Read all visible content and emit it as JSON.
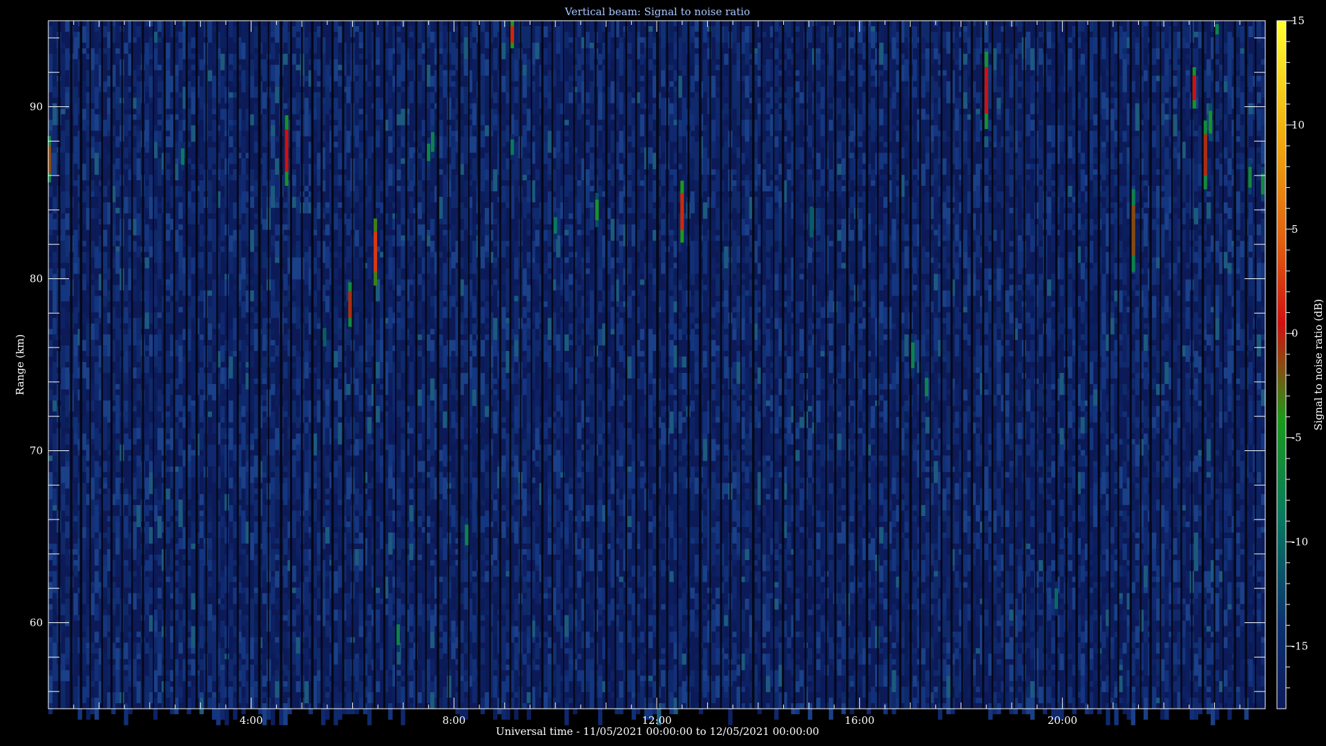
{
  "chart_data": {
    "type": "heatmap",
    "title": "Vertical beam: Signal to noise ratio",
    "xlabel": "Universal time - 11/05/2021 00:00:00 to 12/05/2021 00:00:00",
    "ylabel": "Range (km)",
    "colorbar_label": "Signal to noise ratio (dB)",
    "x_unit": "hours UT",
    "xlim": [
      0,
      24
    ],
    "ylim": [
      55,
      95
    ],
    "clim": [
      -18,
      15
    ],
    "x_ticks": [
      {
        "value": 4,
        "label": "4:00"
      },
      {
        "value": 8,
        "label": "8:00"
      },
      {
        "value": 12,
        "label": "12:00"
      },
      {
        "value": 16,
        "label": "16:00"
      },
      {
        "value": 20,
        "label": "20:00"
      }
    ],
    "y_ticks": [
      {
        "value": 60,
        "label": "60"
      },
      {
        "value": 70,
        "label": "70"
      },
      {
        "value": 80,
        "label": "80"
      },
      {
        "value": 90,
        "label": "90"
      }
    ],
    "colorbar_ticks": [
      {
        "value": 15,
        "label": "15"
      },
      {
        "value": 10,
        "label": "10"
      },
      {
        "value": 5,
        "label": "5"
      },
      {
        "value": 0,
        "label": "0"
      },
      {
        "value": -5,
        "label": "-5"
      },
      {
        "value": -10,
        "label": "-10"
      },
      {
        "value": -15,
        "label": "-15"
      }
    ],
    "background_snr_db": -16,
    "colormap": [
      "#0d1a5c",
      "#0a3070",
      "#087a60",
      "#1a9a1a",
      "#8a4a10",
      "#d01010",
      "#e06010",
      "#f0b010",
      "#ffff30"
    ],
    "echoes": [
      {
        "t": 0.02,
        "r0": 85.6,
        "r1": 88.3,
        "snr": -2
      },
      {
        "t": 2.65,
        "r0": 86.3,
        "r1": 87.9,
        "snr": -9
      },
      {
        "t": 4.7,
        "r0": 85.4,
        "r1": 89.5,
        "snr": 0
      },
      {
        "t": 5.45,
        "r0": 75.7,
        "r1": 77.5,
        "snr": -11
      },
      {
        "t": 5.95,
        "r0": 77.2,
        "r1": 79.8,
        "snr": -1
      },
      {
        "t": 6.45,
        "r0": 79.6,
        "r1": 83.5,
        "snr": 2
      },
      {
        "t": 6.9,
        "r0": 58.3,
        "r1": 60.3,
        "snr": -8
      },
      {
        "t": 7.5,
        "r0": 86.5,
        "r1": 88.2,
        "snr": -8
      },
      {
        "t": 7.58,
        "r0": 87.0,
        "r1": 88.9,
        "snr": -8
      },
      {
        "t": 8.25,
        "r0": 64.1,
        "r1": 66.1,
        "snr": -8
      },
      {
        "t": 9.15,
        "r0": 93.4,
        "r1": 95.0,
        "snr": 1
      },
      {
        "t": 9.15,
        "r0": 86.9,
        "r1": 88.4,
        "snr": -9
      },
      {
        "t": 10.0,
        "r0": 82.3,
        "r1": 83.9,
        "snr": -9
      },
      {
        "t": 10.82,
        "r0": 83.0,
        "r1": 85.0,
        "snr": -6
      },
      {
        "t": 12.5,
        "r0": 82.1,
        "r1": 85.7,
        "snr": 1
      },
      {
        "t": 15.05,
        "r0": 81.8,
        "r1": 84.8,
        "snr": -11
      },
      {
        "t": 17.05,
        "r0": 74.3,
        "r1": 76.8,
        "snr": -8
      },
      {
        "t": 17.32,
        "r0": 72.8,
        "r1": 74.6,
        "snr": -8
      },
      {
        "t": 18.5,
        "r0": 88.7,
        "r1": 93.2,
        "snr": 0
      },
      {
        "t": 19.88,
        "r0": 60.4,
        "r1": 62.4,
        "snr": -10
      },
      {
        "t": 21.4,
        "r0": 80.4,
        "r1": 85.2,
        "snr": -2
      },
      {
        "t": 22.6,
        "r0": 89.9,
        "r1": 92.3,
        "snr": 0
      },
      {
        "t": 22.82,
        "r0": 85.2,
        "r1": 89.2,
        "snr": -1
      },
      {
        "t": 22.92,
        "r0": 88.0,
        "r1": 90.2,
        "snr": -6
      },
      {
        "t": 23.05,
        "r0": 94.0,
        "r1": 95.0,
        "snr": -8
      },
      {
        "t": 23.7,
        "r0": 84.9,
        "r1": 86.9,
        "snr": -7
      },
      {
        "t": 23.95,
        "r0": 84.5,
        "r1": 86.5,
        "snr": -7
      }
    ]
  }
}
